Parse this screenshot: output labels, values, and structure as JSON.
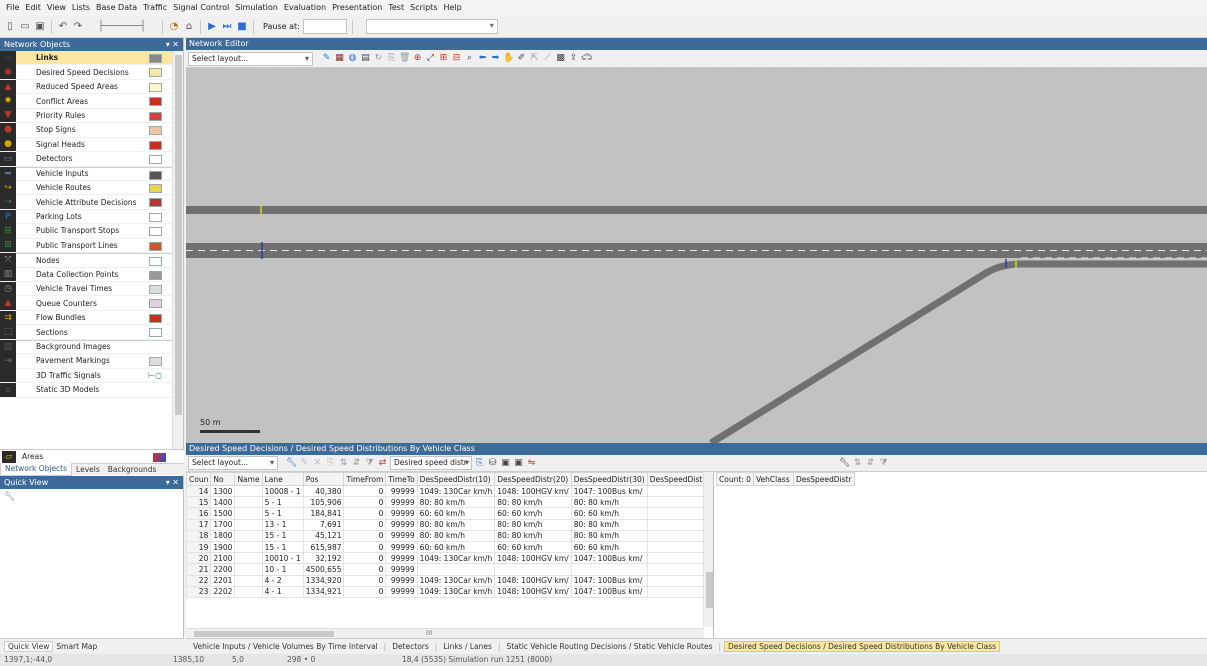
{
  "menu": [
    "File",
    "Edit",
    "View",
    "Lists",
    "Base Data",
    "Traffic",
    "Signal Control",
    "Simulation",
    "Evaluation",
    "Presentation",
    "Test",
    "Scripts",
    "Help"
  ],
  "toolbar": {
    "pause_label": "Pause at:",
    "pause_value": "",
    "combo_value": ""
  },
  "network_objects": {
    "title": "Network Objects",
    "title_controls": "▾ ✕",
    "items": [
      {
        "label": "Links",
        "icon": "links-icon",
        "glyph": "▬",
        "icon_color": "#333",
        "swatch": "#888"
      },
      {
        "label": "Desired Speed Decisions",
        "icon": "desired-speed-icon",
        "glyph": "◉",
        "icon_color": "#c0392b",
        "swatch": "#f3e9a6"
      },
      {
        "label": "Reduced Speed Areas",
        "icon": "reduced-speed-icon",
        "glyph": "▲",
        "icon_color": "#c0392b",
        "swatch": "#fdf7c9"
      },
      {
        "label": "Conflict Areas",
        "icon": "conflict-area-icon",
        "glyph": "✸",
        "icon_color": "#d9a400",
        "swatch": "#c8301e"
      },
      {
        "label": "Priority Rules",
        "icon": "priority-rule-icon",
        "glyph": "▼",
        "icon_color": "#c0392b",
        "swatch": "#d94040"
      },
      {
        "label": "Stop Signs",
        "icon": "stop-sign-icon",
        "glyph": "⬣",
        "icon_color": "#c0392b",
        "swatch": "#f1c6a1"
      },
      {
        "label": "Signal Heads",
        "icon": "signal-head-icon",
        "glyph": "●",
        "icon_color": "#d9a400",
        "swatch": "#c8301e"
      },
      {
        "label": "Detectors",
        "icon": "detector-icon",
        "glyph": "▭",
        "icon_color": "#6a7ca0",
        "swatch": "#ffffff"
      },
      {
        "label": "Vehicle Inputs",
        "icon": "vehicle-input-icon",
        "glyph": "➡",
        "icon_color": "#5a6f9a",
        "swatch": "#555"
      },
      {
        "label": "Vehicle Routes",
        "icon": "vehicle-route-icon",
        "glyph": "↪",
        "icon_color": "#d9a400",
        "swatch": "#e9d44f"
      },
      {
        "label": "Vehicle Attribute Decisions",
        "icon": "attribute-decision-icon",
        "glyph": "⇢",
        "icon_color": "#5a6f9a",
        "swatch": "#b33"
      },
      {
        "label": "Parking Lots",
        "icon": "parking-lot-icon",
        "glyph": "P",
        "icon_color": "#2c6fd1",
        "swatch": "#ffffff"
      },
      {
        "label": "Public Transport Stops",
        "icon": "pt-stop-icon",
        "glyph": "⊞",
        "icon_color": "#2d8a3a",
        "swatch": "#ffffff"
      },
      {
        "label": "Public Transport Lines",
        "icon": "pt-line-icon",
        "glyph": "⊞",
        "icon_color": "#2d8a3a",
        "swatch": "#d9532b"
      },
      {
        "label": "Nodes",
        "icon": "node-icon",
        "glyph": "⤧",
        "icon_color": "#888",
        "swatch": "#ffffff"
      },
      {
        "label": "Data Collection Points",
        "icon": "data-collection-icon",
        "glyph": "▥",
        "icon_color": "#888",
        "swatch": "#999"
      },
      {
        "label": "Vehicle Travel Times",
        "icon": "travel-time-icon",
        "glyph": "◷",
        "icon_color": "#888",
        "swatch": "#dddddd"
      },
      {
        "label": "Queue Counters",
        "icon": "queue-counter-icon",
        "glyph": "▲",
        "icon_color": "#c0392b",
        "swatch": "#e0d0e0"
      },
      {
        "label": "Flow Bundles",
        "icon": "flow-bundle-icon",
        "glyph": "⇉",
        "icon_color": "#d9a400",
        "swatch": "#c8301e"
      },
      {
        "label": "Sections",
        "icon": "section-icon",
        "glyph": "⬚",
        "icon_color": "#888",
        "swatch": "#ffffff"
      },
      {
        "label": "Background Images",
        "icon": "background-image-icon",
        "glyph": "▨",
        "icon_color": "#555",
        "swatch": null
      },
      {
        "label": "Pavement Markings",
        "icon": "pavement-marking-icon",
        "glyph": "⇥",
        "icon_color": "#5a6f9a",
        "swatch": "#dddddd"
      },
      {
        "label": "3D Traffic Signals",
        "icon": "3d-signal-icon",
        "glyph": "⊤",
        "icon_color": "#333",
        "swatch": null
      },
      {
        "label": "Static 3D Models",
        "icon": "static-3d-model-icon",
        "glyph": "⌂",
        "icon_color": "#555",
        "swatch": null
      }
    ],
    "signal_marker": "⊢○",
    "areas_label": "Areas",
    "tabs": [
      "Network Objects",
      "Levels",
      "Backgrounds"
    ]
  },
  "quick_view": {
    "title": "Quick View",
    "title_controls": "▾ ✕"
  },
  "editor": {
    "title": "Network Editor",
    "layout_placeholder": "Select layout...",
    "scale_label": "50 m"
  },
  "list": {
    "title": "Desired Speed Decisions / Desired Speed Distributions By Vehicle Class",
    "layout_placeholder": "Select layout...",
    "attr_combo": "Desired speed distr",
    "columns": [
      "Coun",
      "No",
      "Name",
      "Lane",
      "Pos",
      "TimeFrom",
      "TimeTo",
      "DesSpeedDistr(10)",
      "DesSpeedDistr(20)",
      "DesSpeedDistr(30)",
      "DesSpeedDistr(4"
    ],
    "rows": [
      [
        "14",
        "1300",
        "",
        "10008 - 1",
        "40,380",
        "0",
        "99999",
        "1049: 130Car km/h",
        "1048: 100HGV km/",
        "1047: 100Bus km/",
        ""
      ],
      [
        "15",
        "1400",
        "",
        "5 - 1",
        "105,906",
        "0",
        "99999",
        "80: 80 km/h",
        "80: 80 km/h",
        "80: 80 km/h",
        ""
      ],
      [
        "16",
        "1500",
        "",
        "5 - 1",
        "184,841",
        "0",
        "99999",
        "60: 60 km/h",
        "60: 60 km/h",
        "60: 60 km/h",
        ""
      ],
      [
        "17",
        "1700",
        "",
        "13 - 1",
        "7,691",
        "0",
        "99999",
        "80: 80 km/h",
        "80: 80 km/h",
        "80: 80 km/h",
        ""
      ],
      [
        "18",
        "1800",
        "",
        "15 - 1",
        "45,121",
        "0",
        "99999",
        "80: 80 km/h",
        "80: 80 km/h",
        "80: 80 km/h",
        ""
      ],
      [
        "19",
        "1900",
        "",
        "15 - 1",
        "615,987",
        "0",
        "99999",
        "60: 60 km/h",
        "60: 60 km/h",
        "60: 60 km/h",
        ""
      ],
      [
        "20",
        "2100",
        "",
        "10010 - 1",
        "32,192",
        "0",
        "99999",
        "1049: 130Car km/h",
        "1048: 100HGV km/",
        "1047: 100Bus km/",
        ""
      ],
      [
        "21",
        "2200",
        "",
        "10 - 1",
        "4500,655",
        "0",
        "99999",
        "",
        "",
        "",
        ""
      ],
      [
        "22",
        "2201",
        "",
        "4 - 2",
        "1334,920",
        "0",
        "99999",
        "1049: 130Car km/h",
        "1048: 100HGV km/",
        "1047: 100Bus km/",
        ""
      ],
      [
        "23",
        "2202",
        "",
        "4 - 1",
        "1334,921",
        "0",
        "99999",
        "1049: 130Car km/h",
        "1048: 100HGV km/",
        "1047: 100Bus km/",
        ""
      ]
    ],
    "right_columns": [
      "Count: 0",
      "VehClass",
      "DesSpeedDistr"
    ],
    "hscroll_marker": "III"
  },
  "doc_tabs": [
    "Vehicle Inputs / Vehicle Volumes By Time Interval",
    "Detectors",
    "Links / Lanes",
    "Static Vehicle Routing Decisions / Static Vehicle Routes",
    "Desired Speed Decisions / Desired Speed Distributions By Vehicle Class"
  ],
  "qv_tabs": [
    "Quick View",
    "Smart Map"
  ],
  "status": {
    "coords": "1397,1;-44,0",
    "zoom": "1385,10",
    "speed": "5,0",
    "vehicles": "298 • 0",
    "sim": "18,4 (5535) Simulation run 1251 (8000)"
  },
  "colors": {
    "title_bar": "#3c6a99",
    "selected_row": "#fbe6a3",
    "canvas": "#c2c2c2",
    "road": "#707070"
  }
}
